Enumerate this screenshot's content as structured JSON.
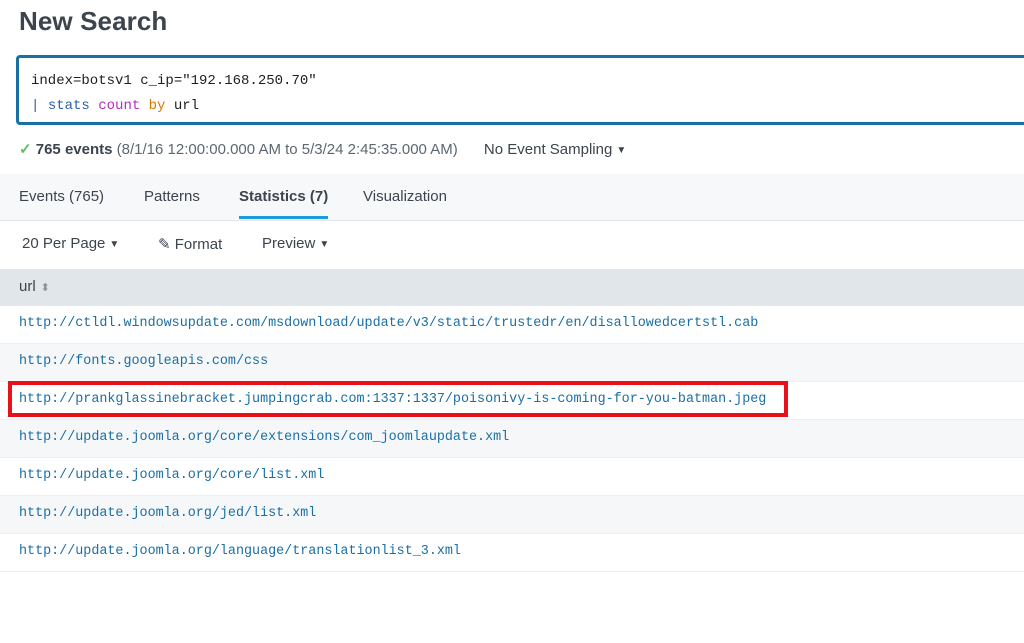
{
  "title": "New Search",
  "search": {
    "line1": "index=botsv1 c_ip=\"192.168.250.70\"",
    "pipe": "|",
    "cmd": "stats",
    "fn": "count",
    "by": "by",
    "field": "url"
  },
  "status": {
    "check": "✓",
    "events": "765 events",
    "range": "(8/1/16 12:00:00.000 AM to 5/3/24 2:45:35.000 AM)",
    "sampling": "No Event Sampling"
  },
  "tabs": [
    {
      "label": "Events (765)"
    },
    {
      "label": "Patterns"
    },
    {
      "label": "Statistics (7)"
    },
    {
      "label": "Visualization"
    }
  ],
  "toolbar": {
    "per_page": "20 Per Page",
    "format": "Format",
    "preview": "Preview"
  },
  "table": {
    "column": "url",
    "rows": [
      "http://ctldl.windowsupdate.com/msdownload/update/v3/static/trustedr/en/disallowedcertstl.cab",
      "http://fonts.googleapis.com/css",
      "http://prankglassinebracket.jumpingcrab.com:1337:1337/poisonivy-is-coming-for-you-batman.jpeg",
      "http://update.joomla.org/core/extensions/com_joomlaupdate.xml",
      "http://update.joomla.org/core/list.xml",
      "http://update.joomla.org/jed/list.xml",
      "http://update.joomla.org/language/translationlist_3.xml"
    ]
  },
  "colors": {
    "accent": "#1a9cd8",
    "link": "#1a6fa3",
    "highlight": "#e8101a"
  }
}
